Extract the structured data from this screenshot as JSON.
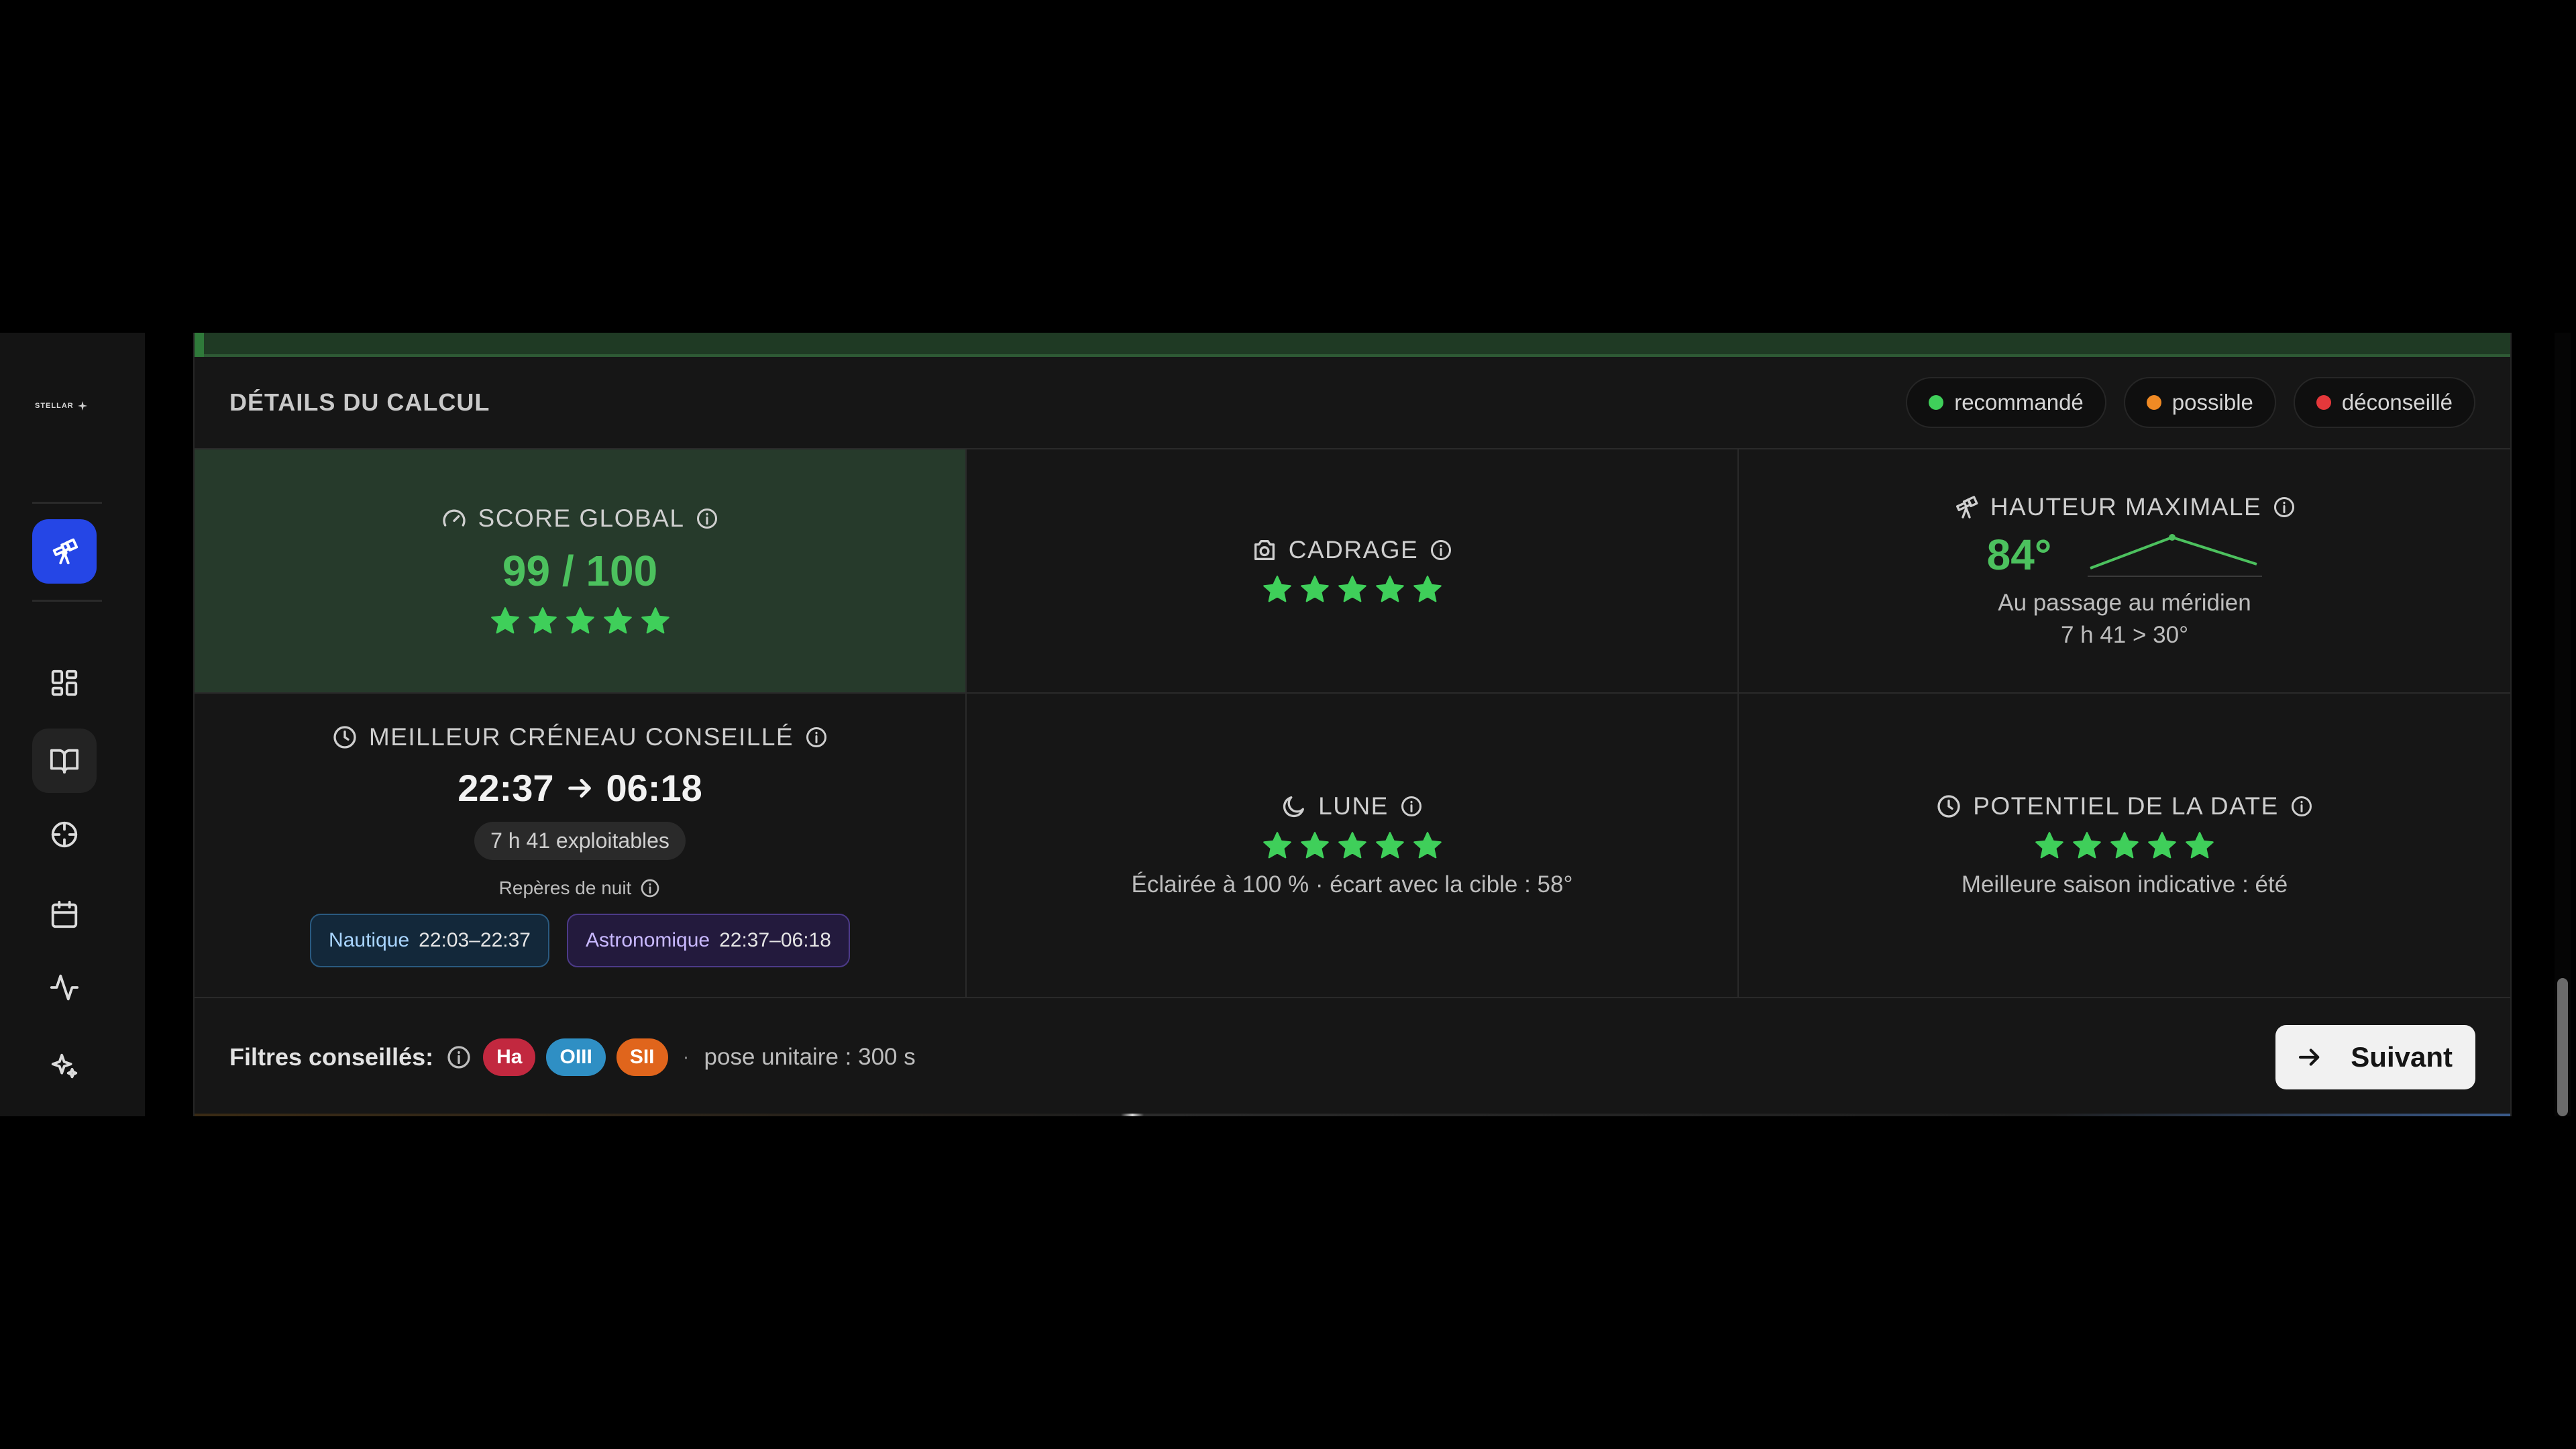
{
  "app": {
    "logo_text": "STELLAR"
  },
  "sidebar": {
    "items": [
      {
        "name": "telescope",
        "active": true
      },
      {
        "name": "dashboard"
      },
      {
        "name": "catalog"
      },
      {
        "name": "target"
      },
      {
        "name": "calendar"
      },
      {
        "name": "activity"
      },
      {
        "name": "sparkles"
      }
    ]
  },
  "panel": {
    "title": "DÉTAILS DU CALCUL",
    "legend": [
      {
        "label": "recommandé",
        "color": "#3fcf5a"
      },
      {
        "label": "possible",
        "color": "#f08a24"
      },
      {
        "label": "déconseillé",
        "color": "#e5383b"
      }
    ]
  },
  "score": {
    "label": "SCORE GLOBAL",
    "value": "99 / 100",
    "stars": 5
  },
  "framing": {
    "label": "CADRAGE",
    "stars": 5
  },
  "altitude": {
    "label": "HAUTEUR MAXIMALE",
    "value": "84°",
    "line1": "Au passage au méridien",
    "line2": "7 h 41 > 30°"
  },
  "window": {
    "label": "MEILLEUR CRÉNEAU CONSEILLÉ",
    "start": "22:37",
    "end": "06:18",
    "usable": "7 h 41 exploitables",
    "night_label": "Repères de nuit",
    "nautical": {
      "label": "Nautique",
      "time": "22:03–22:37"
    },
    "astronomical": {
      "label": "Astronomique",
      "time": "22:37–06:18"
    }
  },
  "moon": {
    "label": "LUNE",
    "stars": 5,
    "text": "Éclairée à 100 % · écart avec la cible : 58°"
  },
  "date_potential": {
    "label": "POTENTIEL DE LA DATE",
    "stars": 5,
    "text": "Meilleure saison indicative : été"
  },
  "footer": {
    "filters_label": "Filtres conseillés:",
    "filters": [
      {
        "label": "Ha",
        "color": "#c2283f"
      },
      {
        "label": "OIII",
        "color": "#2f8fc4"
      },
      {
        "label": "SII",
        "color": "#e0651c"
      }
    ],
    "separator": "·",
    "pose": "pose unitaire : 300 s",
    "next_label": "Suivant"
  },
  "colors": {
    "accent_green": "#4cc15e",
    "star_green": "#3fcf5a",
    "active_blue": "#2546e6"
  }
}
